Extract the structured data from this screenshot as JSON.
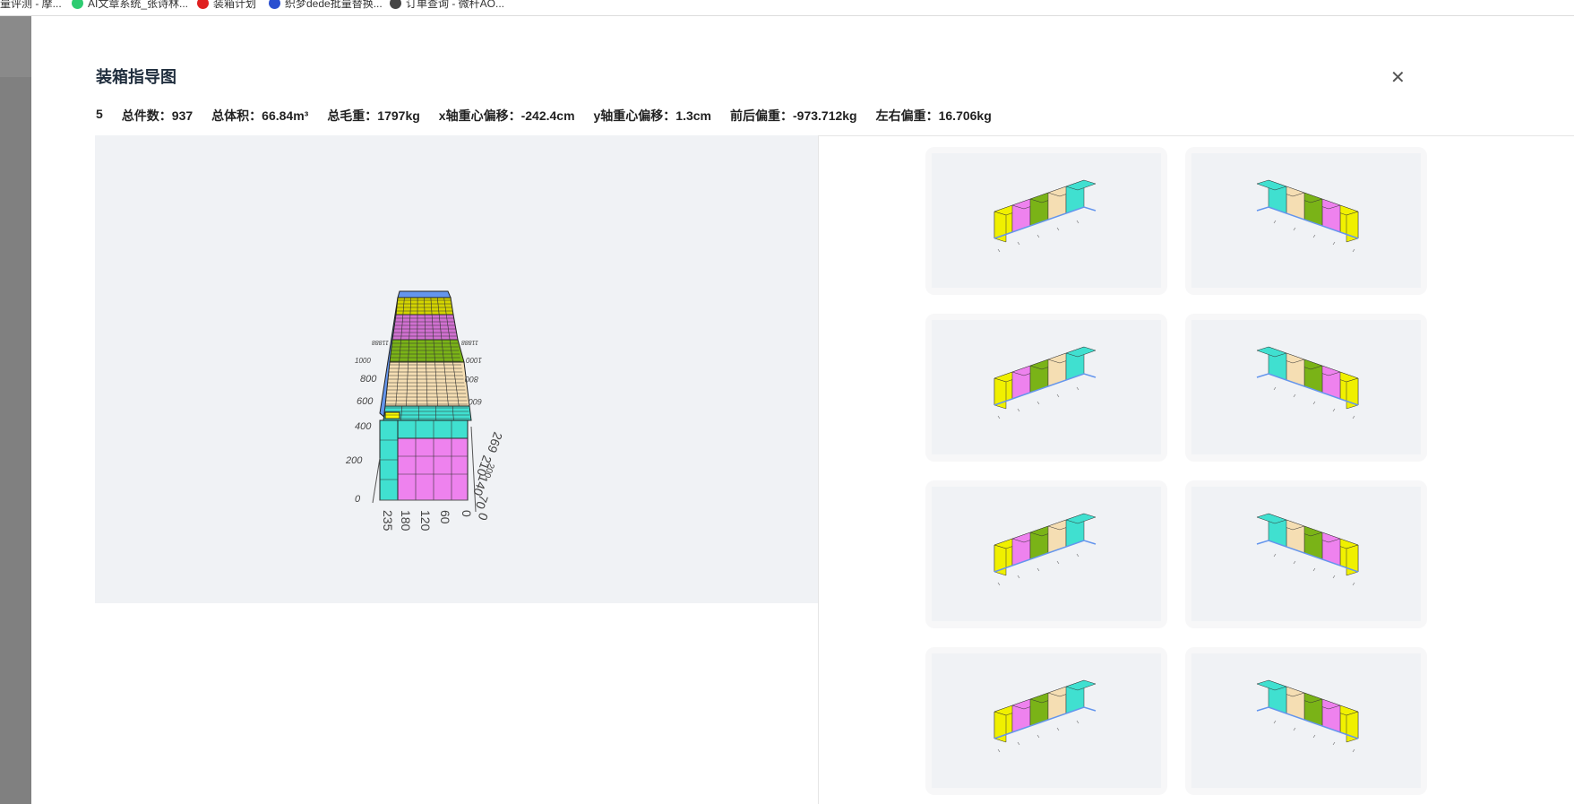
{
  "bookmarks": [
    {
      "label": "量评测 - 摩...",
      "color": "#888"
    },
    {
      "label": "AI文章系统_张诗林...",
      "color": "#2ecc71"
    },
    {
      "label": "装箱计划",
      "color": "#e02020"
    },
    {
      "label": "织梦dede批量替换...",
      "color": "#2a4fd0"
    },
    {
      "label": "订单查询 - 微秆AO...",
      "color": "#444"
    }
  ],
  "modal": {
    "title": "装箱指导图",
    "close_icon": "close-icon",
    "stats": [
      "5",
      "总件数：937",
      "总体积：66.84m³",
      "总毛重：1797kg",
      "x轴重心偏移：-242.4cm",
      "y轴重心偏移：1.3cm",
      "前后偏重：-973.712kg",
      "左右偏重：16.706kg"
    ]
  },
  "main_view": {
    "left_axis": [
      "0",
      "200",
      "400",
      "600",
      "800",
      "1000",
      "11888"
    ],
    "right_axis": [
      "600",
      "800",
      "1000",
      "11888"
    ],
    "bottom_axis": [
      "235",
      "180",
      "120",
      "60",
      "0"
    ],
    "side_axis": [
      "0",
      "70",
      "140",
      "210",
      "269",
      "200"
    ],
    "colors": {
      "turquoise": "#40e0d0",
      "violet": "#ee82ee",
      "tan": "#f5deb3",
      "olive": "#7ab317",
      "yellow": "#f0f000",
      "magenta": "#d070d0",
      "blue": "#6495ed"
    }
  },
  "thumbnails": [
    {
      "flip": false
    },
    {
      "flip": true
    },
    {
      "flip": false
    },
    {
      "flip": true
    },
    {
      "flip": false
    },
    {
      "flip": true
    },
    {
      "flip": false
    },
    {
      "flip": true
    }
  ]
}
